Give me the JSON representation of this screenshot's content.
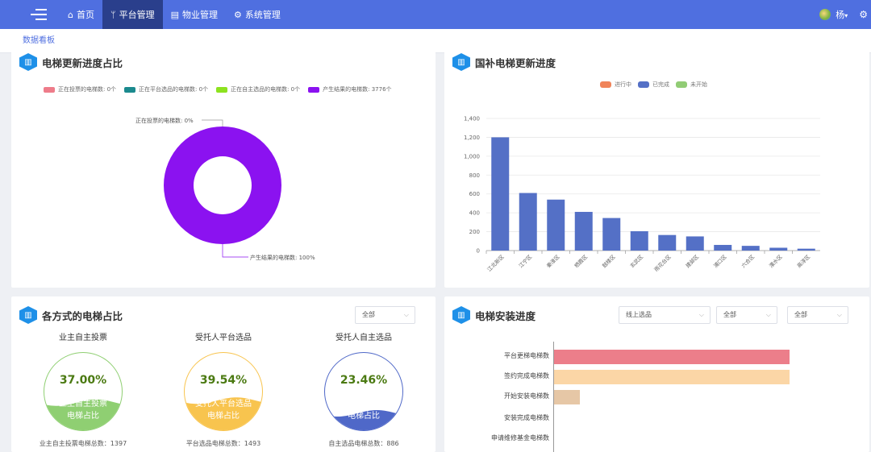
{
  "nav": {
    "items": [
      {
        "icon": "⌂",
        "label": "首页"
      },
      {
        "icon": "ᛘ",
        "label": "平台管理"
      },
      {
        "icon": "▤",
        "label": "物业管理"
      },
      {
        "icon": "⚙",
        "label": "系统管理"
      }
    ],
    "active_index": 1,
    "user_name": "杨",
    "user_caret": "▾"
  },
  "tabs": [
    "数据看板"
  ],
  "panel1": {
    "title": "电梯更新进度占比",
    "legend": [
      {
        "label": "正在投票的电梯数: 0个",
        "color": "#ee7c8a"
      },
      {
        "label": "正在平台选品的电梯数: 0个",
        "color": "#1b8a8e"
      },
      {
        "label": "正在自主选品的电梯数: 0个",
        "color": "#8de21f"
      },
      {
        "label": "产生结果的电梯数: 3776个",
        "color": "#8b12f0"
      }
    ],
    "callouts": {
      "top": "正在投票的电梯数: 0%",
      "bottom": "产生结果的电梯数: 100%"
    },
    "chart_data": {
      "type": "pie",
      "labels": [
        "正在投票的电梯数",
        "正在平台选品的电梯数",
        "正在自主选品的电梯数",
        "产生结果的电梯数"
      ],
      "values": [
        0,
        0,
        0,
        3776
      ],
      "colors": [
        "#ee7c8a",
        "#1b8a8e",
        "#8de21f",
        "#8b12f0"
      ]
    }
  },
  "panel2": {
    "title": "国补电梯更新进度",
    "legend": [
      {
        "label": "进行中",
        "color": "#f0845a"
      },
      {
        "label": "已完成",
        "color": "#5470c6"
      },
      {
        "label": "未开始",
        "color": "#91cc75"
      }
    ],
    "chart_data": {
      "type": "bar",
      "categories": [
        "江北新区",
        "江宁区",
        "秦淮区",
        "栖霞区",
        "鼓楼区",
        "玄武区",
        "雨花台区",
        "建邺区",
        "浦口区",
        "六合区",
        "溧水区",
        "高淳区"
      ],
      "y_ticks": [
        "0",
        "200",
        "400",
        "600",
        "800",
        "1,000",
        "1,200",
        "1,400"
      ],
      "series": [
        {
          "name": "已完成",
          "color": "#5470c6",
          "values": [
            1200,
            610,
            540,
            410,
            345,
            205,
            165,
            150,
            60,
            50,
            30,
            20
          ]
        }
      ],
      "ylim": [
        0,
        1400
      ]
    }
  },
  "panel3": {
    "title": "各方式的电梯占比",
    "select": "全部",
    "items": [
      {
        "title": "业主自主投票",
        "pct": "37.00%",
        "pct_value": 37.0,
        "label1": "业主自主投票",
        "label2": "电梯占比",
        "count": "业主自主投票电梯总数：1397",
        "color": "#8fcf72"
      },
      {
        "title": "受托人平台选品",
        "pct": "39.54%",
        "pct_value": 39.54,
        "label1": "受托人平台选品",
        "label2": "电梯占比",
        "count": "平台选品电梯总数：1493",
        "color": "#f8c44e"
      },
      {
        "title": "受托人自主选品",
        "pct": "23.46%",
        "pct_value": 23.46,
        "label1": "受托人自主选品",
        "label2": "电梯占比",
        "count": "自主选品电梯总数：886",
        "color": "#4f68c8"
      }
    ]
  },
  "panel4": {
    "title": "电梯安装进度",
    "selects": [
      "线上选品",
      "全部",
      "全部"
    ],
    "chart_data": {
      "type": "bar",
      "orientation": "horizontal",
      "categories": [
        "平台更梯电梯数",
        "签约完成电梯数",
        "开始安装电梯数",
        "安装完成电梯数",
        "申请维修基金电梯数"
      ],
      "values": [
        100,
        100,
        11,
        0,
        0
      ],
      "colors": [
        "#ec7e8a",
        "#fbd6a6",
        "#e6c7a6",
        "#cccccc",
        "#cccccc"
      ]
    }
  }
}
